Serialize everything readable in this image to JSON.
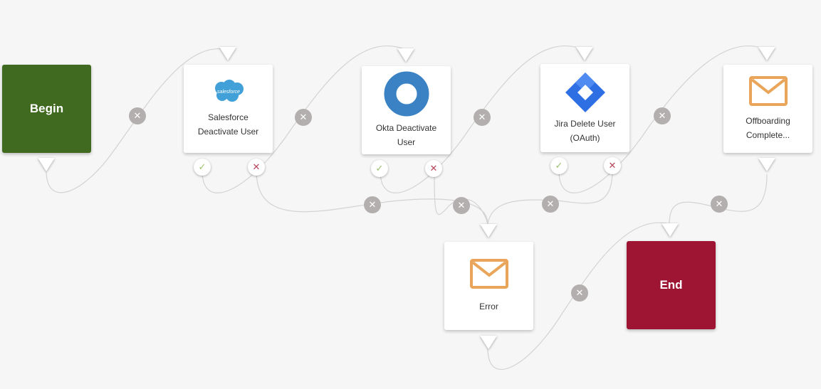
{
  "nodes": {
    "begin": {
      "label": "Begin"
    },
    "salesforce": {
      "label_line1": "Salesforce",
      "label_line2": "Deactivate User",
      "logo_text": "salesforce"
    },
    "okta": {
      "label_line1": "Okta Deactivate",
      "label_line2": "User"
    },
    "jira": {
      "label_line1": "Jira Delete User",
      "label_line2": "(OAuth)"
    },
    "offboarding": {
      "label_line1": "Offboarding",
      "label_line2": "Complete..."
    },
    "error": {
      "label": "Error"
    },
    "end": {
      "label": "End"
    }
  },
  "glyphs": {
    "remove": "✕",
    "success": "✓",
    "failure": "✕"
  },
  "colors": {
    "begin": "#3f6a20",
    "end": "#9e1433",
    "salesforce": "#41a0d8",
    "okta": "#3a82c4",
    "jira": "#2f6fe4",
    "mail": "#e9a55a",
    "wire": "#d3d3d3",
    "remove_button": "#b3afaf"
  },
  "icons": {
    "salesforce": "salesforce-cloud-icon",
    "okta": "okta-ring-icon",
    "jira": "jira-diamond-icon",
    "offboarding": "mail-envelope-icon",
    "error": "mail-envelope-icon"
  }
}
